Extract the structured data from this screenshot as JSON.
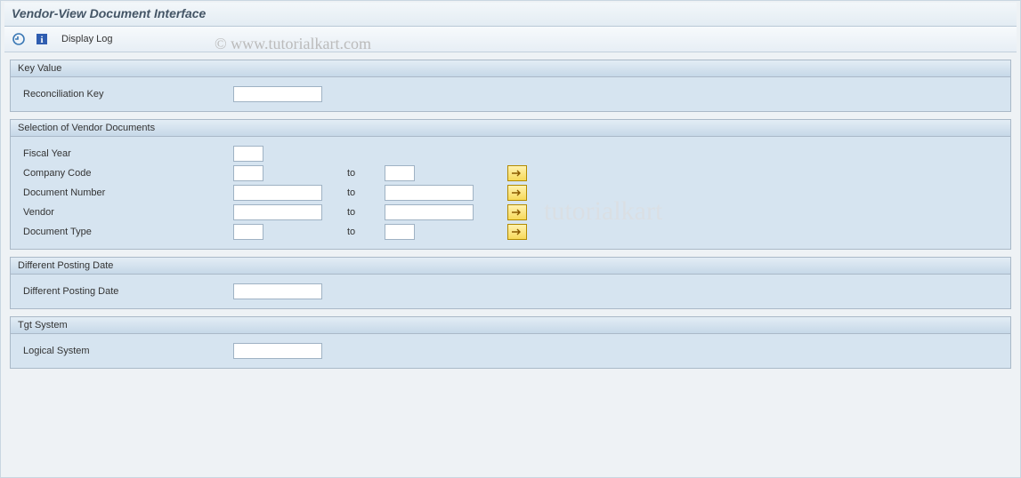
{
  "header": {
    "title": "Vendor-View Document Interface"
  },
  "toolbar": {
    "execute_tooltip": "Execute",
    "info_tooltip": "Information",
    "display_log_label": "Display Log"
  },
  "groups": {
    "key_value": {
      "title": "Key Value",
      "reconciliation_key_label": "Reconciliation Key",
      "reconciliation_key_value": ""
    },
    "selection": {
      "title": "Selection of Vendor Documents",
      "to_label": "to",
      "fiscal_year": {
        "label": "Fiscal Year",
        "from": ""
      },
      "company_code": {
        "label": "Company Code",
        "from": "",
        "to": ""
      },
      "document_number": {
        "label": "Document Number",
        "from": "",
        "to": ""
      },
      "vendor": {
        "label": "Vendor",
        "from": "",
        "to": ""
      },
      "document_type": {
        "label": "Document Type",
        "from": "",
        "to": ""
      }
    },
    "diff_posting": {
      "title": "Different Posting Date",
      "label": "Different Posting Date",
      "value": ""
    },
    "tgt_system": {
      "title": "Tgt System",
      "logical_system_label": "Logical System",
      "logical_system_value": ""
    }
  },
  "watermark": "© www.tutorialkart.com",
  "watermark2": "tutorialkart"
}
